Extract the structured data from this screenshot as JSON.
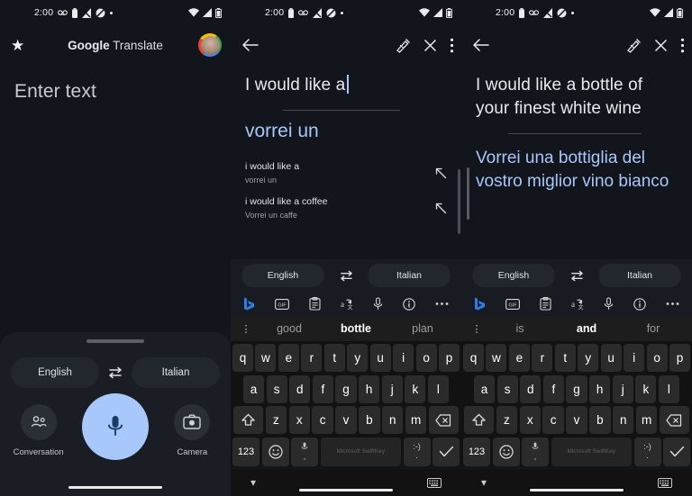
{
  "statusbar": {
    "time": "2:00",
    "left_icons": [
      "voicemail-icon",
      "battery-saver-icon",
      "signal-bars-icon",
      "do-not-disturb-icon",
      "dot-icon"
    ],
    "right_icons": [
      "wifi-icon",
      "cellular-icon",
      "battery-icon"
    ]
  },
  "panel1": {
    "appbar": {
      "star_icon": "star-icon",
      "title_bold": "Google",
      "title_light": " Translate",
      "avatar": "avatar"
    },
    "input_placeholder": "Enter text",
    "langbar": {
      "source": "English",
      "swap_icon": "swap-languages-icon",
      "target": "Italian"
    },
    "actions": [
      {
        "label": "Conversation",
        "icon": "conversation-icon"
      },
      {
        "label": "",
        "icon": "microphone-icon"
      },
      {
        "label": "Camera",
        "icon": "camera-icon"
      }
    ]
  },
  "panel2": {
    "appbar": {
      "back_icon": "back-arrow-icon",
      "handwriting_icon": "handwriting-icon",
      "close_icon": "close-icon",
      "more_icon": "more-vertical-icon"
    },
    "source_text": "I would like a",
    "target_text": "vorrei un",
    "suggestions": [
      {
        "main": "i would like a",
        "sub": "vorrei un",
        "arrow_icon": "insert-arrow-icon"
      },
      {
        "main": "i would like a coffee",
        "sub": "Vorrei un caffe",
        "arrow_icon": "insert-arrow-icon"
      }
    ],
    "keyboard": {
      "langbar": {
        "source": "English",
        "swap_icon": "swap-languages-icon",
        "target": "Italian"
      },
      "toolbar_icons": [
        "bing-icon",
        "gif-icon",
        "clipboard-icon",
        "translate-sticker-icon",
        "microphone-icon",
        "info-icon",
        "more-horizontal-icon"
      ],
      "suggestion_strip": {
        "expand_icon": "expand-suggestions-icon",
        "words": [
          "good",
          "bottle",
          "plan"
        ],
        "active_index": 1
      },
      "row1": [
        "q",
        "w",
        "e",
        "r",
        "t",
        "y",
        "u",
        "i",
        "o",
        "p"
      ],
      "row2": [
        "a",
        "s",
        "d",
        "f",
        "g",
        "h",
        "j",
        "k",
        "l"
      ],
      "row3": [
        "z",
        "x",
        "c",
        "v",
        "b",
        "n",
        "m"
      ],
      "shift_icon": "shift-icon",
      "backspace_icon": "backspace-icon",
      "numeric_key": "123",
      "emoji_icon": "emoji-icon",
      "mic_key_icon": "microphone-icon",
      "comma_key": ",",
      "space_watermark": "Microsoft SwiftKey",
      "period_key": ".",
      "enter_icon": "check-icon",
      "collapse_icon": "collapse-keyboard-icon",
      "switch_keyboard_icon": "switch-keyboard-icon"
    }
  },
  "panel3": {
    "appbar": {
      "back_icon": "back-arrow-icon",
      "handwriting_icon": "handwriting-icon",
      "close_icon": "close-icon",
      "more_icon": "more-vertical-icon"
    },
    "source_text": "I would like a bottle of your finest white wine",
    "target_text": "Vorrei una bottiglia del vostro miglior vino bianco",
    "keyboard": {
      "langbar": {
        "source": "English",
        "swap_icon": "swap-languages-icon",
        "target": "Italian"
      },
      "toolbar_icons": [
        "bing-icon",
        "gif-icon",
        "clipboard-icon",
        "translate-sticker-icon",
        "microphone-icon",
        "info-icon",
        "more-horizontal-icon"
      ],
      "suggestion_strip": {
        "expand_icon": "expand-suggestions-icon",
        "words": [
          "is",
          "and",
          "for"
        ],
        "active_index": 1
      },
      "row1": [
        "q",
        "w",
        "e",
        "r",
        "t",
        "y",
        "u",
        "i",
        "o",
        "p"
      ],
      "row2": [
        "a",
        "s",
        "d",
        "f",
        "g",
        "h",
        "j",
        "k",
        "l"
      ],
      "row3": [
        "z",
        "x",
        "c",
        "v",
        "b",
        "n",
        "m"
      ],
      "shift_icon": "shift-icon",
      "backspace_icon": "backspace-icon",
      "numeric_key": "123",
      "emoji_icon": "emoji-icon",
      "mic_key_icon": "microphone-icon",
      "comma_key": ",",
      "space_watermark": "Microsoft SwiftKey",
      "period_key": ".",
      "enter_icon": "check-icon",
      "collapse_icon": "collapse-keyboard-icon",
      "switch_keyboard_icon": "switch-keyboard-icon"
    }
  },
  "colors": {
    "background": "#12151b",
    "sheet": "#1a1d23",
    "accent_blue": "#a8c7fa",
    "text_primary": "#e8eaed",
    "text_secondary": "#9aa0a6",
    "keyboard_bg": "#121212",
    "key_bg": "#2b2b2b"
  }
}
